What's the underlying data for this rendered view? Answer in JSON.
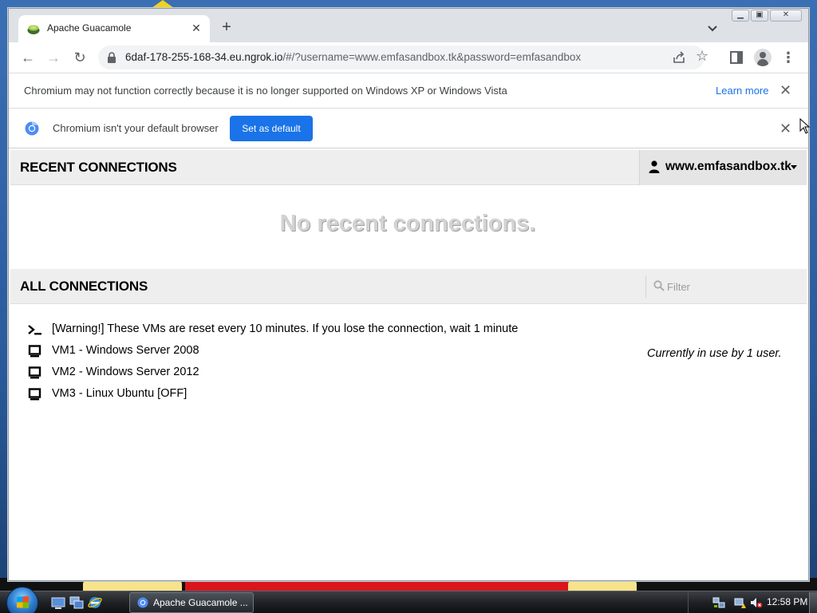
{
  "browser": {
    "tab": {
      "title": "Apache Guacamole"
    },
    "toolbar": {
      "url_host": "6daf-178-255-168-34.eu.ngrok.io",
      "url_path": "/#/?username=www.emfasandbox.tk&password=emfasandbox"
    },
    "infobars": {
      "unsupported": {
        "message": "Chromium may not function correctly because it is no longer supported on Windows XP or Windows Vista",
        "link": "Learn more"
      },
      "default_browser": {
        "message": "Chromium isn't your default browser",
        "button": "Set as default"
      }
    }
  },
  "guacamole": {
    "recent": {
      "header": "RECENT CONNECTIONS",
      "empty": "No recent connections."
    },
    "user_menu": {
      "username": "www.emfasandbox.tk"
    },
    "all": {
      "header": "ALL CONNECTIONS",
      "filter_placeholder": "Filter",
      "connections": [
        {
          "name": "[Warning!] These VMs are reset every 10 minutes. If you lose the connection, wait 1 minute",
          "icon": "terminal-icon"
        },
        {
          "name": "VM1 - Windows Server 2008",
          "icon": "monitor-icon"
        },
        {
          "name": "VM2 - Windows Server 2012",
          "icon": "monitor-icon"
        },
        {
          "name": "VM3 - Linux Ubuntu [OFF]",
          "icon": "monitor-icon"
        }
      ],
      "usage_note": "Currently in use by 1 user."
    }
  },
  "taskbar": {
    "task_button": "Apache Guacamole ...",
    "clock": "12:58 PM"
  },
  "colors": {
    "accent": "#1a73e8",
    "no_recent_text": "#d3d3d3",
    "header_bg": "#eeeeee"
  }
}
